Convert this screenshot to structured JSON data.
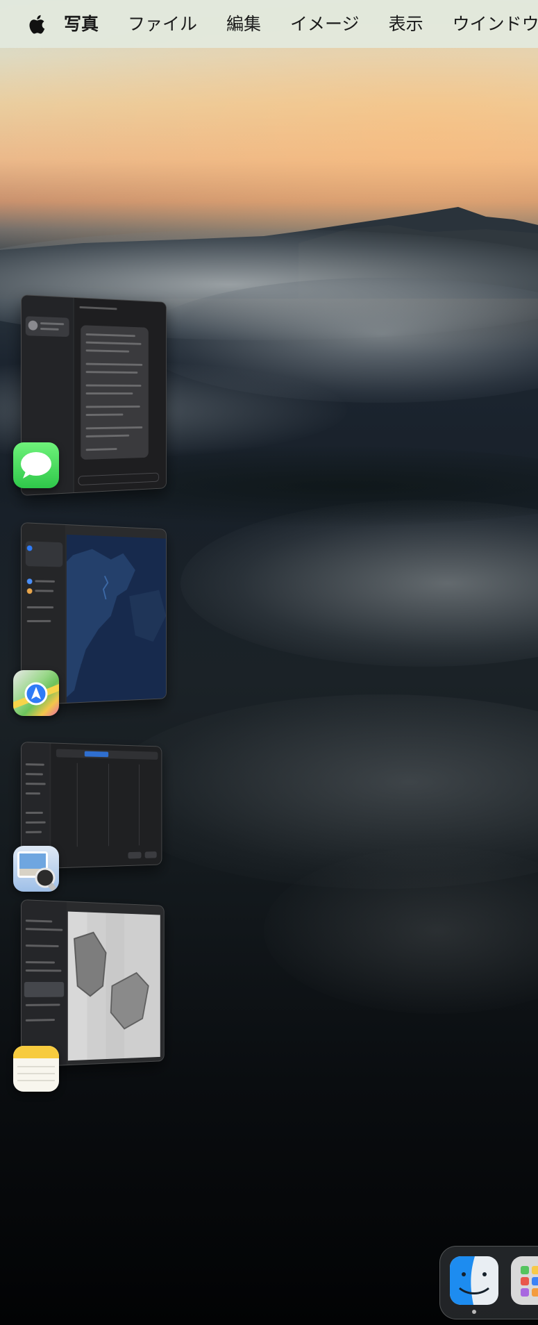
{
  "menubar": {
    "apple_icon": "apple-logo-icon",
    "app_name": "写真",
    "items": [
      "ファイル",
      "編集",
      "イメージ",
      "表示",
      "ウインドウ"
    ]
  },
  "stage_manager": {
    "windows": [
      {
        "app": "Messages",
        "icon": "messages-icon",
        "accent": "#3fd35a"
      },
      {
        "app": "Maps",
        "icon": "maps-icon",
        "accent": "#2f7bf6"
      },
      {
        "app": "Preview",
        "icon": "preview-icon",
        "accent": "#8fb7e8"
      },
      {
        "app": "Notes",
        "icon": "notes-icon",
        "accent": "#f7cb3e"
      }
    ]
  },
  "dock": {
    "items": [
      {
        "app": "Finder",
        "icon": "finder-icon",
        "running": true
      },
      {
        "app": "Launchpad",
        "icon": "launchpad-icon",
        "running": false
      }
    ]
  }
}
